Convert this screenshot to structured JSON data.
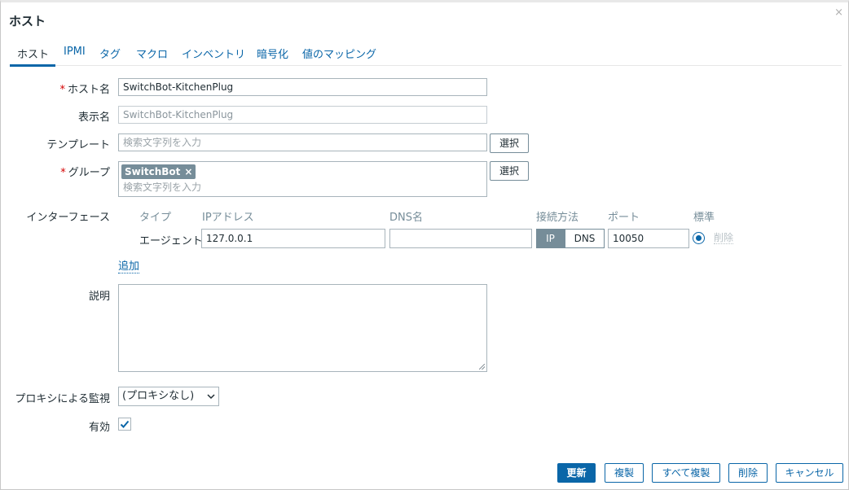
{
  "dialog": {
    "title": "ホスト",
    "close_glyph": "×"
  },
  "tabs": [
    {
      "label": "ホスト"
    },
    {
      "label": "IPMI"
    },
    {
      "label": "タグ"
    },
    {
      "label": "マクロ"
    },
    {
      "label": "インベントリ"
    },
    {
      "label": "暗号化"
    },
    {
      "label": "値のマッピング"
    }
  ],
  "form": {
    "required_mark": "*",
    "host_name": {
      "label": "ホスト名",
      "value": "SwitchBot-KitchenPlug"
    },
    "visible_name": {
      "label": "表示名",
      "value": "SwitchBot-KitchenPlug"
    },
    "templates": {
      "label": "テンプレート",
      "placeholder": "検索文字列を入力",
      "select_label": "選択"
    },
    "groups": {
      "label": "グループ",
      "chip": "SwitchBot",
      "chip_remove": "×",
      "placeholder": "検索文字列を入力",
      "select_label": "選択"
    },
    "interfaces": {
      "label": "インターフェース",
      "headers": {
        "type": "タイプ",
        "ip": "IPアドレス",
        "dns": "DNS名",
        "connect": "接続方法",
        "port": "ポート",
        "default": "標準"
      },
      "row": {
        "type": "エージェント",
        "ip": "127.0.0.1",
        "dns": "",
        "connect_ip": "IP",
        "connect_dns": "DNS",
        "port": "10050",
        "remove": "削除"
      },
      "add_label": "追加"
    },
    "description": {
      "label": "説明",
      "value": ""
    },
    "proxy": {
      "label": "プロキシによる監視",
      "value": "(プロキシなし)"
    },
    "enabled": {
      "label": "有効",
      "checked": true
    }
  },
  "footer": {
    "update": "更新",
    "clone": "複製",
    "full_clone": "すべて複製",
    "delete": "削除",
    "cancel": "キャンセル"
  },
  "colors": {
    "accent": "#0a66a8",
    "required": "#d40000",
    "chip": "#768d99"
  }
}
